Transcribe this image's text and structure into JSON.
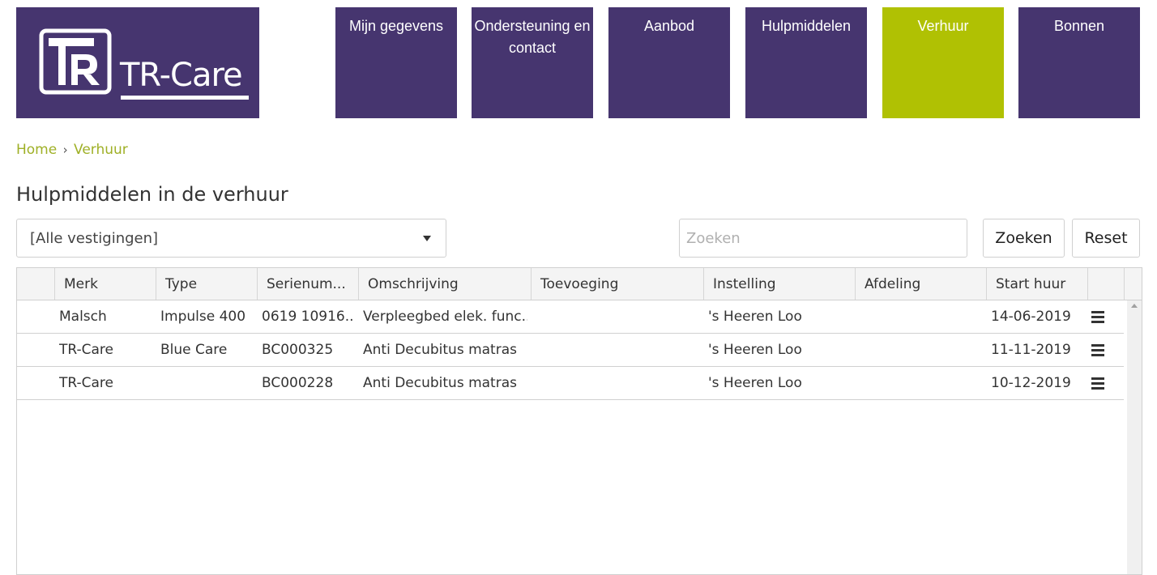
{
  "logo": {
    "text": "TR-Care"
  },
  "nav": {
    "items": [
      {
        "label": "Mijn gegevens"
      },
      {
        "label": "Ondersteuning en contact"
      },
      {
        "label": "Aanbod"
      },
      {
        "label": "Hulpmiddelen"
      },
      {
        "label": "Verhuur",
        "active": true
      },
      {
        "label": "Bonnen"
      }
    ]
  },
  "breadcrumb": {
    "home": "Home",
    "separator": "›",
    "current": "Verhuur"
  },
  "page": {
    "title": "Hulpmiddelen in de verhuur"
  },
  "filter": {
    "selected": "[Alle vestigingen]"
  },
  "search": {
    "placeholder": "Zoeken",
    "value": ""
  },
  "buttons": {
    "search": "Zoeken",
    "reset": "Reset"
  },
  "table": {
    "columns": [
      "Merk",
      "Type",
      "Serienum...",
      "Omschrijving",
      "Toevoeging",
      "Instelling",
      "Afdeling",
      "Start huur"
    ],
    "rows": [
      {
        "merk": "Malsch",
        "type": "Impulse 400",
        "serienummer": "0619 10916...",
        "omschrijving": "Verpleegbed elek. func...",
        "toevoeging": "",
        "instelling": "'s Heeren Loo",
        "afdeling": "",
        "start_huur": "14-06-2019"
      },
      {
        "merk": "TR-Care",
        "type": "Blue Care",
        "serienummer": "BC000325",
        "omschrijving": "Anti Decubitus matras",
        "toevoeging": "",
        "instelling": "'s Heeren Loo",
        "afdeling": "",
        "start_huur": "11-11-2019"
      },
      {
        "merk": "TR-Care",
        "type": "",
        "serienummer": "BC000228",
        "omschrijving": "Anti Decubitus matras",
        "toevoeging": "",
        "instelling": "'s Heeren Loo",
        "afdeling": "",
        "start_huur": "10-12-2019"
      }
    ]
  },
  "colors": {
    "brand_purple": "#46356f",
    "accent_green": "#b0c103",
    "breadcrumb_green": "#9fb026"
  }
}
